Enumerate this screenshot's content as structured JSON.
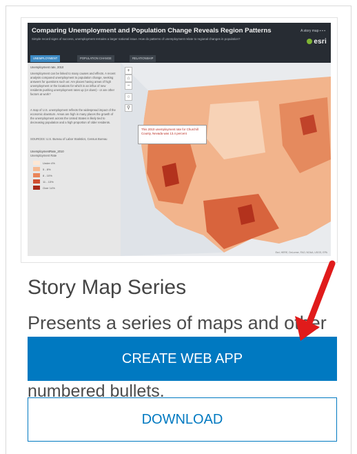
{
  "thumbnail": {
    "title": "Comparing Unemployment and Population Change Reveals Region Patterns",
    "subtitle": "Simple record signs of success, unemployment remains a larger national issue. How do patterns of unemployment relate to regional changes in population?",
    "share_text": "A story map",
    "brand": "esri",
    "tabs": [
      "UNEMPLOYMENT",
      "POPULATION CHANGE",
      "RELATIONSHIP"
    ],
    "side_heading": "Unemployment rate, 2010",
    "side_para1": "Unemployment can be linked to many causes and effects. A recent analysis compared unemployment to population change, seeking answers for questions such as: Are places having areas of high unemployment or the locations for which is an influx of new residents pushing unemployment rates up (or down) - or are other factors at work?",
    "side_para2": "A map of U.S. unemployment reflects the widespread impact of the economic downturn. Areas are high in many places the growth of the unemployment across the United States is likely tied to decreasing population and a high proportion of older residents.",
    "side_source": "SOURCES: U.S. Bureau of Labor Statistics, Census Bureau",
    "legend_title": "UnemploymentRate_2010",
    "legend_subtitle": "Unemployment Rate",
    "legend_items": [
      "Under 4%",
      "5 - 8%",
      "8 - 10%",
      "11 - 13%",
      "Over 14%"
    ],
    "legend_colors": [
      "#fde7d4",
      "#f6b991",
      "#ea8559",
      "#cf4f31",
      "#a82a1a"
    ],
    "popup_text": "This 2010 unemployment rate for Churchill County, Nevada was 13.4 percent",
    "attribution": "Esri, HERE, DeLorme, FAO, NOAA, USGS, EPA"
  },
  "card": {
    "title": "Story Map Series",
    "description_line1": "Presents a series of maps and other",
    "description_line2": "numbered bullets.",
    "create_button": "CREATE WEB APP",
    "download_button": "DOWNLOAD"
  },
  "colors": {
    "primary": "#0079c1",
    "arrow": "#e01b1b"
  }
}
